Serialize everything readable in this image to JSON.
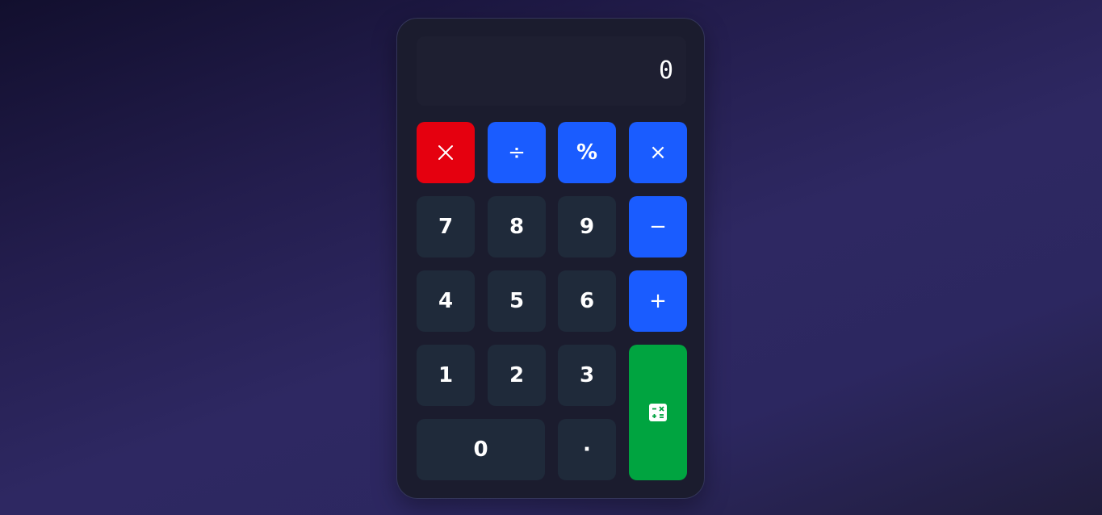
{
  "display": {
    "value": "0"
  },
  "keys": {
    "clear_icon": "close-icon",
    "divide": "÷",
    "percent": "%",
    "multiply": "×",
    "subtract": "−",
    "add": "+",
    "equals_icon": "calculator-icon",
    "seven": "7",
    "eight": "8",
    "nine": "9",
    "four": "4",
    "five": "5",
    "six": "6",
    "one": "1",
    "two": "2",
    "three": "3",
    "zero": "0",
    "decimal": "·"
  },
  "colors": {
    "clear": "#e5000f",
    "operator": "#1a5cff",
    "number": "#1f2a3a",
    "equals": "#00a440"
  }
}
